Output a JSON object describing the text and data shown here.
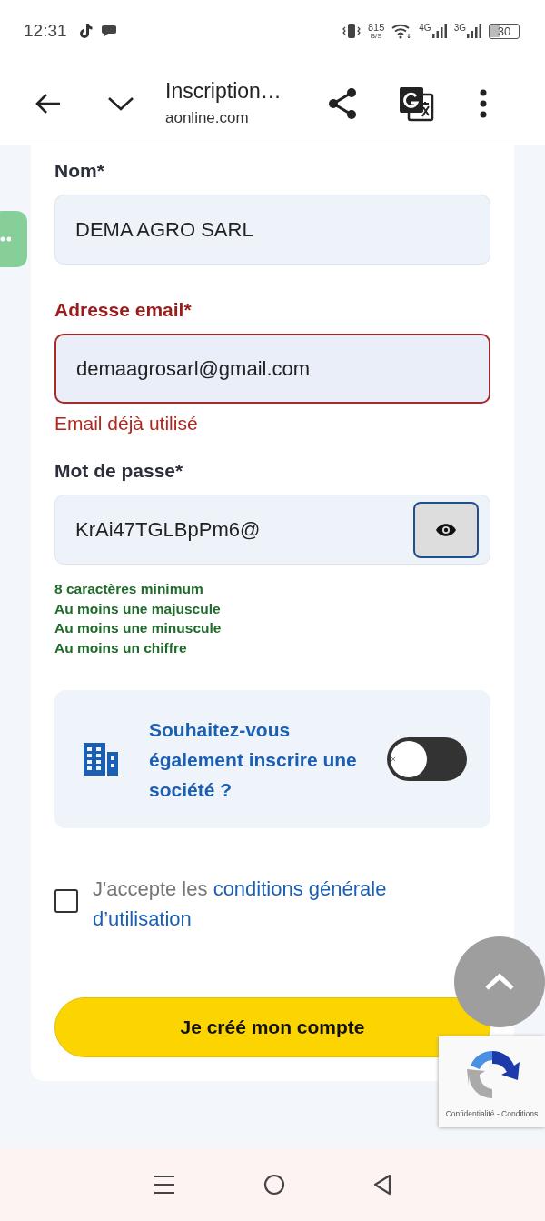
{
  "status_bar": {
    "time": "12:31",
    "net_speed": "815",
    "net_unit": "B/S",
    "networks": [
      "4G",
      "3G"
    ],
    "battery": "30"
  },
  "browser": {
    "title": "Inscription…",
    "url": "aonline.com"
  },
  "fields": [
    {
      "label": "Nom*",
      "value": "DEMA AGRO SARL",
      "error": false,
      "kind": "text"
    },
    {
      "label": "Adresse email*",
      "value": "demaagrosarl@gmail.com",
      "error": true,
      "error_text": "Email déjà utilisé",
      "kind": "text"
    },
    {
      "label": "Mot de passe*",
      "value": "KrAi47TGLBpPm6@",
      "error": false,
      "kind": "password"
    }
  ],
  "password_hints": [
    "8 caractères minimum",
    "Au moins une majuscule",
    "Au moins une minuscule",
    "Au moins un chiffre"
  ],
  "company": {
    "text": "Souhaitez-vous également inscrire une société ?",
    "on": false
  },
  "terms": {
    "checked": false,
    "text": "J'accepte les",
    "link_lines": [
      "conditions générale",
      "d’utilisation"
    ]
  },
  "submit": "Je créé mon compte",
  "recaptcha": "Confidentialité - Conditions"
}
